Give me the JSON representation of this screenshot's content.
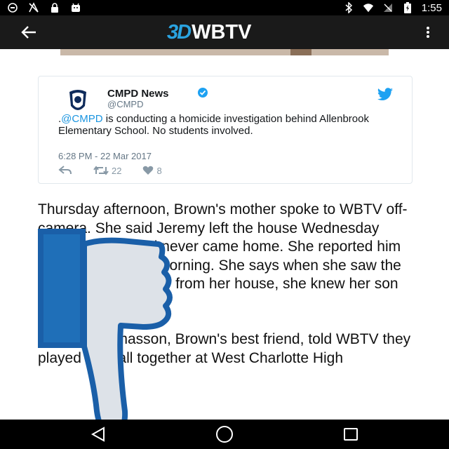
{
  "status_bar": {
    "time": "1:55",
    "left_icons": [
      "circle-icon",
      "signal-off-icon",
      "lock-icon",
      "android-icon"
    ],
    "right_icons": [
      "bluetooth-icon",
      "wifi-icon",
      "no-sim-icon",
      "battery-charging-icon"
    ]
  },
  "app_bar": {
    "logo_3d": "3D",
    "logo_text": "WBTV",
    "back_icon": "arrow-back-icon",
    "menu_icon": "more-vert-icon"
  },
  "tweet": {
    "name": "CMPD News",
    "handle": "@CMPD",
    "text_prefix": ".",
    "mention": "@CMPD",
    "text_body": " is conducting a homicide investigation behind Allenbrook Elementary School. No students involved.",
    "timestamp": "6:28 PM - 22 Mar 2017",
    "retweets": "22",
    "likes": "8",
    "colors": {
      "mention": "#1b95e0",
      "bird": "#1da1f2",
      "verified": "#1da1f2"
    }
  },
  "article": {
    "paragraphs": [
      "Thursday afternoon, Brown's mother spoke to WBTV off-camera. She said Jeremy left the house Wednesday around 7 p.m. and never came home. She reported him missing Thursday morning. She says when she saw the police activity not far from her house, she knew her son was gone.",
      "Jeremy Thomasson, Brown's best friend, told WBTV they played football together at West Charlotte High"
    ]
  },
  "overlay": {
    "icon": "thumbs-down-icon",
    "fill": "#dde2e8",
    "stroke": "#1a5fa8",
    "cuff": "#1f6fb8"
  },
  "nav_bar": {
    "icons": [
      "back-triangle-icon",
      "home-circle-icon",
      "recents-square-icon"
    ]
  }
}
